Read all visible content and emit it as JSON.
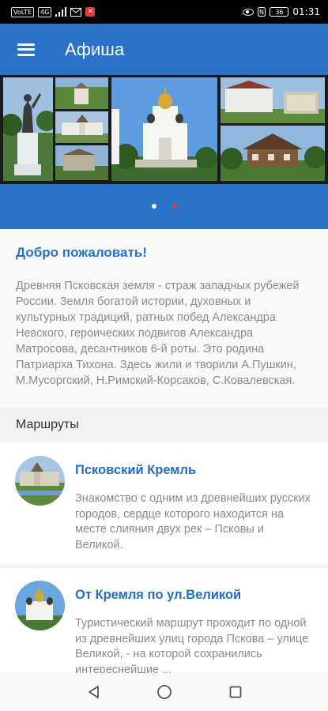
{
  "status_bar": {
    "carrier_chip": "VoLTE",
    "signal_chip": "4G",
    "battery": "36",
    "time": "01:31"
  },
  "app_bar": {
    "title": "Афиша",
    "menu_icon": "hamburger-menu-icon"
  },
  "carousel": {
    "slide_count": 2,
    "active_slide": 2,
    "dot_inactive_color": "#ffffff",
    "dot_active_color": "#e53935"
  },
  "welcome": {
    "title": "Добро пожаловать!",
    "text": "Древняя Псковская земля - страж западных рубежей России. Земля богатой истории, духовных и культурных традиций, ратных побед Александра Невского, героических подвигов Александра Матросова, десантников 6-й роты. Это родина Патриарха Тихона. Здесь жили и творили А.Пушкин, М.Мусоргский, Н.Римский-Корсаков, С.Ковалевская."
  },
  "routes_section": {
    "header": "Маршруты",
    "items": [
      {
        "title": "Псковский Кремль",
        "description": "Знакомство с одним из древнейших русских городов, сердце которого находится на месте слияния двух рек – Псковы и Великой."
      },
      {
        "title": "От Кремля по ул.Великой",
        "description": "Туристический маршрут проходит по одной из древнейших улиц города Пскова – улице Великой, - на которой сохранились интереснейшие ..."
      }
    ]
  },
  "nav_bar": {
    "back_icon": "back-triangle-icon",
    "home_icon": "home-circle-icon",
    "recents_icon": "recents-square-icon"
  },
  "colors": {
    "primary": "#2a72c8",
    "link": "#1f6fc6",
    "text_muted": "#8a8a8a"
  }
}
